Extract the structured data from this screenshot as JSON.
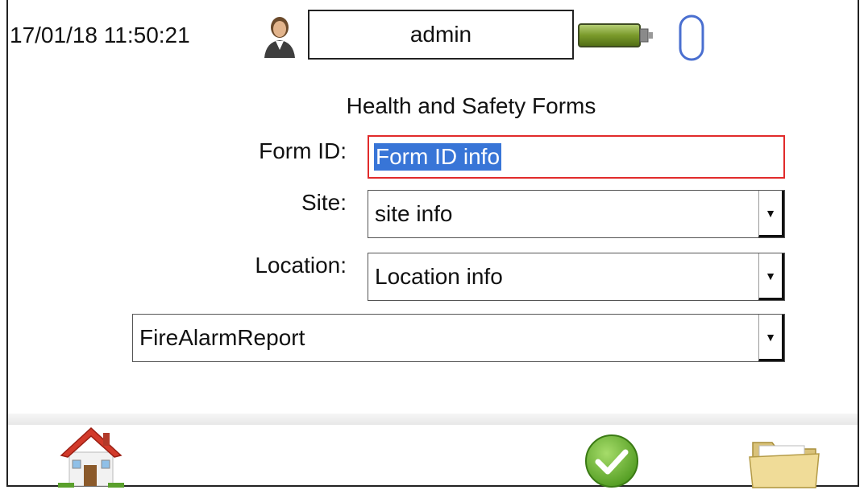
{
  "header": {
    "datetime": "17/01/18 11:50:21",
    "user_name": "admin",
    "user_icon": "user-avatar-icon",
    "battery_icon": "battery-icon",
    "mouse_icon": "mouse-icon"
  },
  "form": {
    "title": "Health and Safety Forms",
    "form_id_label": "Form ID:",
    "form_id_value": "Form ID info",
    "site_label": "Site:",
    "site_value": "site info",
    "location_label": "Location:",
    "location_value": "Location info",
    "report_value": "FireAlarmReport"
  },
  "footer": {
    "home_icon": "home-icon",
    "confirm_icon": "check-icon",
    "folder_icon": "folder-icon"
  },
  "colors": {
    "selection": "#3875d7",
    "focus_border": "#e12b2b",
    "confirm_green": "#6db33f"
  }
}
